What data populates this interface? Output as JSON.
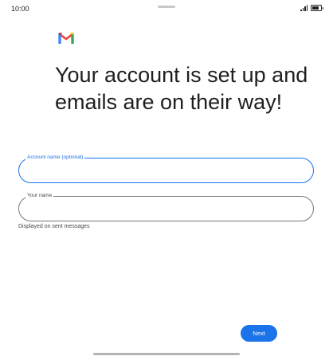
{
  "status_bar": {
    "time": "10:00",
    "icons": [
      "signal-icon",
      "battery-icon"
    ]
  },
  "logo": {
    "icon": "gmail-logo",
    "colors": [
      "#4285f4",
      "#ea4335",
      "#fbbc04",
      "#34a853",
      "#c5221f"
    ]
  },
  "headline": "Your account is set up and emails are on their way!",
  "form": {
    "account_name": {
      "label": "Account name (optional)",
      "value": "",
      "state": "focused"
    },
    "your_name": {
      "label": "Your name",
      "value": "",
      "helper": "Displayed on sent messages"
    }
  },
  "actions": {
    "next_label": "Next"
  },
  "colors": {
    "accent": "#1a73e8",
    "text": "#1f1f1f",
    "outline": "#747775"
  }
}
